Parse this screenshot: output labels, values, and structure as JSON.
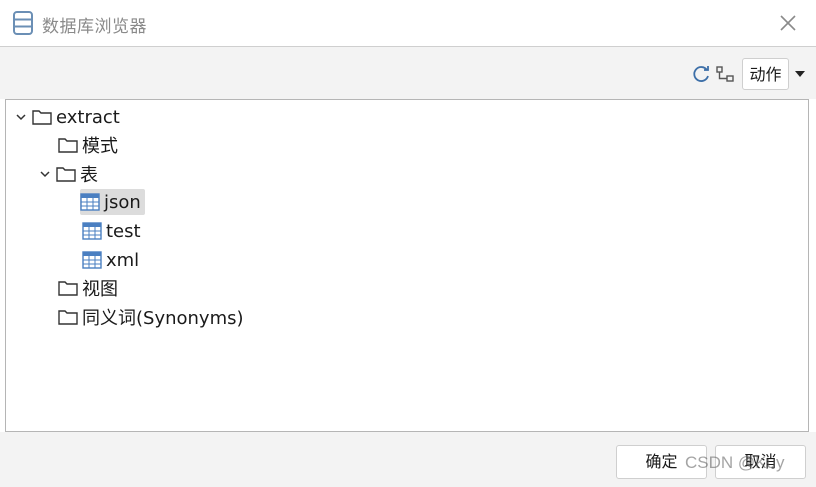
{
  "window": {
    "title": "数据库浏览器",
    "icon": "database-icon"
  },
  "toolbar": {
    "refresh_icon": "refresh-icon",
    "link_icon": "link-icon",
    "action_label": "动作"
  },
  "tree": {
    "root": {
      "label": "extract",
      "expanded": true
    },
    "schemas": {
      "label": "模式"
    },
    "tables": {
      "label": "表",
      "expanded": true
    },
    "table_items": [
      {
        "label": "json",
        "selected": true
      },
      {
        "label": "test"
      },
      {
        "label": "xml"
      }
    ],
    "views": {
      "label": "视图"
    },
    "synonyms": {
      "label": "同义词(Synonyms)"
    }
  },
  "footer": {
    "ok_label": "确定",
    "cancel_label": "取消"
  },
  "watermark": "CSDN @Kuy",
  "colors": {
    "table_icon": "#4a7fc1",
    "selected_bg": "#dcdcdc",
    "panel_bg": "#f3f3f3"
  }
}
